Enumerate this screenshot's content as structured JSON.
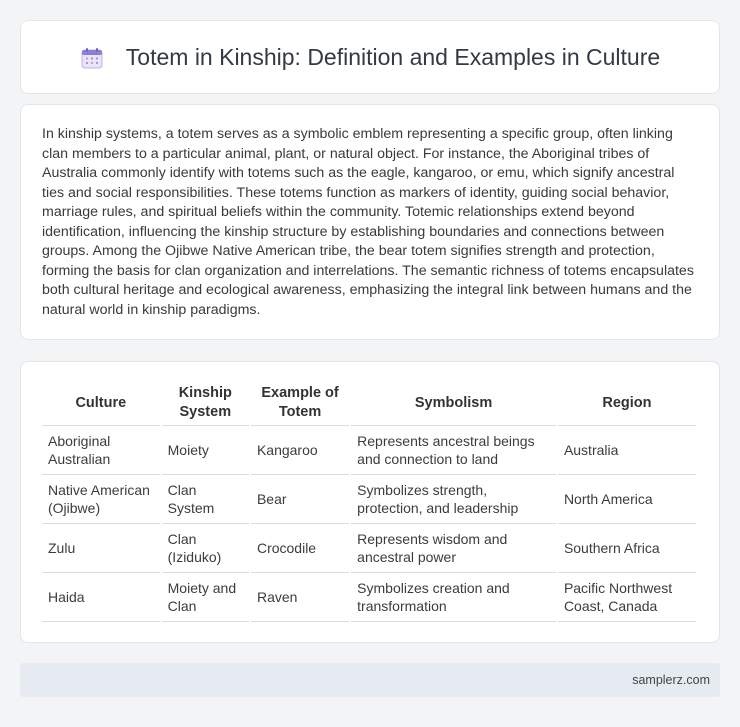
{
  "header": {
    "icon": "calendar-icon",
    "title": "Totem in Kinship: Definition and Examples in Culture"
  },
  "intro": {
    "text": "In kinship systems, a totem serves as a symbolic emblem representing a specific group, often linking clan members to a particular animal, plant, or natural object. For instance, the Aboriginal tribes of Australia commonly identify with totems such as the eagle, kangaroo, or emu, which signify ancestral ties and social responsibilities. These totems function as markers of identity, guiding social behavior, marriage rules, and spiritual beliefs within the community. Totemic relationships extend beyond identification, influencing the kinship structure by establishing boundaries and connections between groups. Among the Ojibwe Native American tribe, the bear totem signifies strength and protection, forming the basis for clan organization and interrelations. The semantic richness of totems encapsulates both cultural heritage and ecological awareness, emphasizing the integral link between humans and the natural world in kinship paradigms."
  },
  "table": {
    "headers": [
      "Culture",
      "Kinship System",
      "Example of Totem",
      "Symbolism",
      "Region"
    ],
    "rows": [
      [
        "Aboriginal Australian",
        "Moiety",
        "Kangaroo",
        "Represents ancestral beings and connection to land",
        "Australia"
      ],
      [
        "Native American (Ojibwe)",
        "Clan System",
        "Bear",
        "Symbolizes strength, protection, and leadership",
        "North America"
      ],
      [
        "Zulu",
        "Clan (Iziduko)",
        "Crocodile",
        "Represents wisdom and ancestral power",
        "Southern Africa"
      ],
      [
        "Haida",
        "Moiety and Clan",
        "Raven",
        "Symbolizes creation and transformation",
        "Pacific Northwest Coast, Canada"
      ]
    ]
  },
  "footer": {
    "site": "samplerz.com"
  },
  "colors": {
    "background": "#f3f4f6",
    "card": "#ffffff",
    "footer": "#e6ebf2",
    "icon_accent": "#8b7fd6"
  }
}
